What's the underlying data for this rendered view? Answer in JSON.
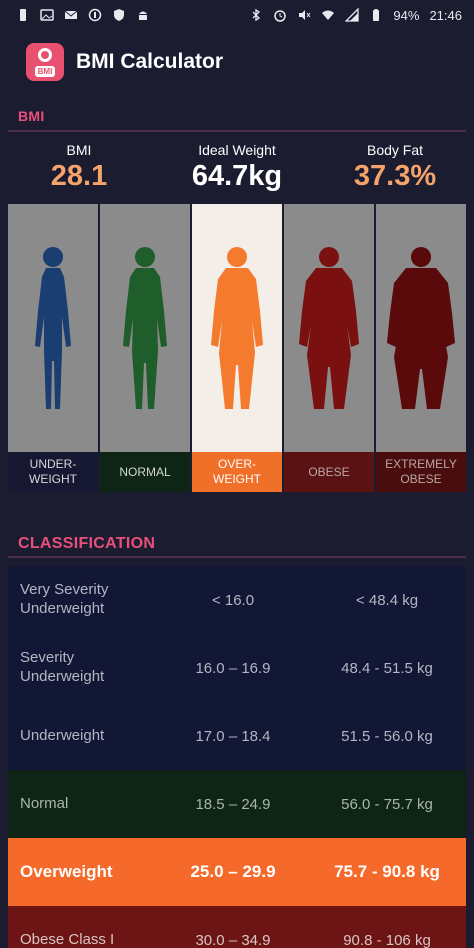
{
  "status_bar": {
    "battery": "94%",
    "time": "21:46",
    "left_icons": [
      "battery-saver-icon",
      "photo-icon",
      "mail-icon",
      "vpn-icon",
      "shield-icon",
      "android-icon"
    ],
    "right_icons": [
      "bluetooth-icon",
      "alarm-icon",
      "mute-icon",
      "wifi-icon",
      "signal-icon",
      "battery-icon"
    ]
  },
  "app_bar": {
    "title": "BMI Calculator",
    "logo_tag": "BMI"
  },
  "bmi_section": {
    "header": "BMI"
  },
  "stats": [
    {
      "label": "BMI",
      "value": "28.1"
    },
    {
      "label": "Ideal Weight",
      "value": "64.7kg"
    },
    {
      "label": "Body Fat",
      "value": "37.3%"
    }
  ],
  "figures": [
    {
      "label": "UNDER-\nWEIGHT",
      "color": "#1a3e72"
    },
    {
      "label": "NORMAL",
      "color": "#1f5d2a"
    },
    {
      "label": "OVER-\nWEIGHT",
      "color": "#f47a2e"
    },
    {
      "label": "OBESE",
      "color": "#7a1010"
    },
    {
      "label": "EXTREMELY\nOBESE",
      "color": "#5a0a0a"
    }
  ],
  "active_figure": "OVER-\nWEIGHT",
  "classification": {
    "header": "CLASSIFICATION",
    "rows": [
      {
        "name": "Very Severity Underweight",
        "bmi": "< 16.0",
        "weight": "< 48.4 kg"
      },
      {
        "name": "Severity Underweight",
        "bmi": "16.0 – 16.9",
        "weight": "48.4 - 51.5 kg"
      },
      {
        "name": "Underweight",
        "bmi": "17.0 – 18.4",
        "weight": "51.5 - 56.0 kg"
      },
      {
        "name": "Normal",
        "bmi": "18.5 – 24.9",
        "weight": "56.0 - 75.7 kg"
      },
      {
        "name": "Overweight",
        "bmi": "25.0 – 29.9",
        "weight": "75.7 - 90.8 kg"
      },
      {
        "name": "Obese Class I",
        "bmi": "30.0 – 34.9",
        "weight": "90.8 - 106 kg"
      }
    ]
  },
  "colors": {
    "background": "#1b1c30",
    "accent": "#e8507a",
    "highlight": "#f56a2a"
  }
}
